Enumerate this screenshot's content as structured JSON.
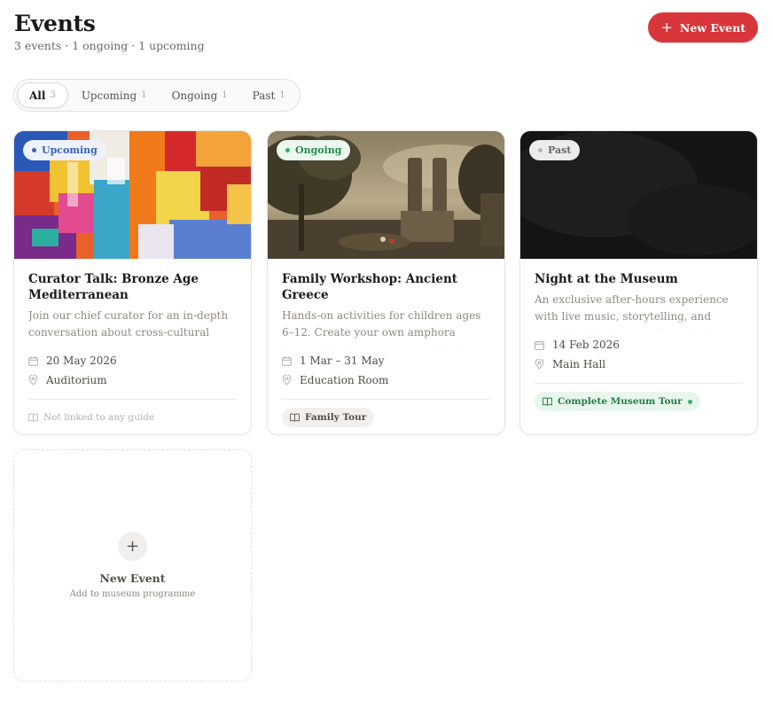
{
  "header": {
    "title": "Events",
    "subtitle": "3 events · 1 ongoing · 1 upcoming",
    "new_event_label": "New Event",
    "new_event_icon": "plus-icon"
  },
  "tabs": [
    {
      "label": "All",
      "count": "3",
      "active": true
    },
    {
      "label": "Upcoming",
      "count": "1"
    },
    {
      "label": "Ongoing",
      "count": "1"
    },
    {
      "label": "Past",
      "count": "1"
    }
  ],
  "cards": [
    {
      "status": "Upcoming",
      "title": "Curator Talk: Bronze Age Mediterranean",
      "description": "Join our chief curator for an in-depth conversation about cross-cultural exchan...",
      "date": "20 May 2026",
      "location": "Auditorium",
      "guide": "Not linked to any guide"
    },
    {
      "status": "Ongoing",
      "title": "Family Workshop: Ancient Greece",
      "description": "Hands-on activities for children ages 6–12. Create your own amphora inspired by the... museum collection",
      "date": "1 Mar – 31 May",
      "location": "Education Room",
      "guide": "Family Tour"
    },
    {
      "status": "Past",
      "title": "Night at the Museum",
      "description": "An exclusive after-hours experience with live music, storytelling, and special guided... tours through the permanent collection",
      "date": "14 Feb 2026",
      "location": "Main Hall",
      "guide": "Complete Museum Tour"
    }
  ],
  "add_card": {
    "title": "New Event",
    "subtitle": "Add to museum programme"
  },
  "colors": {
    "accent": "#d8363a",
    "upcoming": "#3b63b8",
    "ongoing": "#2b8a4e",
    "past": "#6b6863"
  },
  "icons": {
    "date": "calendar-icon",
    "location": "location-pin-icon",
    "guide": "book-icon",
    "add": "plus-icon"
  }
}
